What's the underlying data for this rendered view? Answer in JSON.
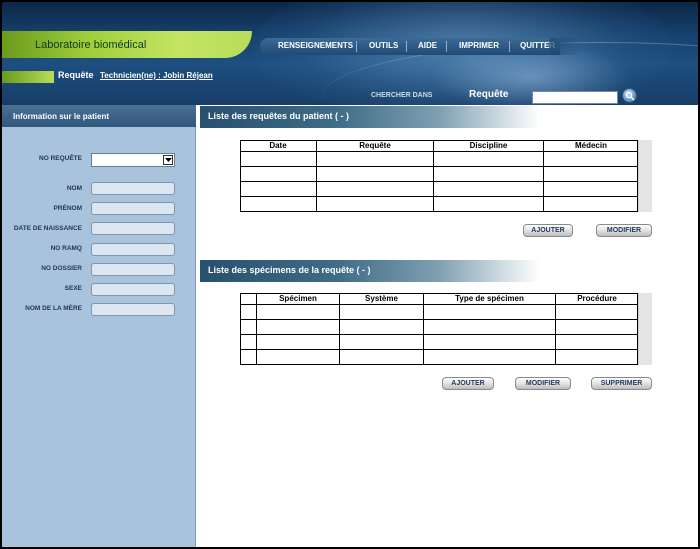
{
  "header": {
    "app_title": "Laboratoire biomédical",
    "menu": [
      "RENSEIGNEMENTS",
      "OUTILS",
      "AIDE",
      "IMPRIMER",
      "QUITTER"
    ],
    "page_title": "Requête",
    "technician_link": "Technicien(ne) : Jobin Réjean",
    "search_in_label": "CHERCHER DANS",
    "search_target": "Requête",
    "search_value": "",
    "search_icon": "magnifier-icon"
  },
  "sidebar": {
    "title": "Information sur le patient",
    "fields": [
      {
        "label": "NO REQUÊTE",
        "type": "select",
        "value": ""
      },
      {
        "label": "NOM",
        "value": ""
      },
      {
        "label": "PRÉNOM",
        "value": ""
      },
      {
        "label": "DATE DE NAISSANCE",
        "value": ""
      },
      {
        "label": "NO RAMQ",
        "value": ""
      },
      {
        "label": "NO DOSSIER",
        "value": ""
      },
      {
        "label": "SEXE",
        "value": ""
      },
      {
        "label": "NOM DE LA MÈRE",
        "value": ""
      }
    ]
  },
  "requests_section": {
    "title": "Liste des requêtes du patient ( - )",
    "columns": [
      "Date",
      "Requête",
      "Discipline",
      "Médecin"
    ],
    "rows": [],
    "buttons": {
      "add": "AJOUTER",
      "modify": "MODIFIER"
    }
  },
  "specimens_section": {
    "title": "Liste des spécimens de la requête ( - )",
    "columns": [
      "",
      "Spécimen",
      "Système",
      "Type de spécimen",
      "Procédure"
    ],
    "rows": [],
    "buttons": {
      "add": "AJOUTER",
      "modify": "MODIFIER",
      "delete": "SUPPRIMER"
    }
  },
  "colors": {
    "header_blue": "#1d4f80",
    "accent_green": "#9fcf3a",
    "sidebar_blue": "#a9c3dc"
  }
}
